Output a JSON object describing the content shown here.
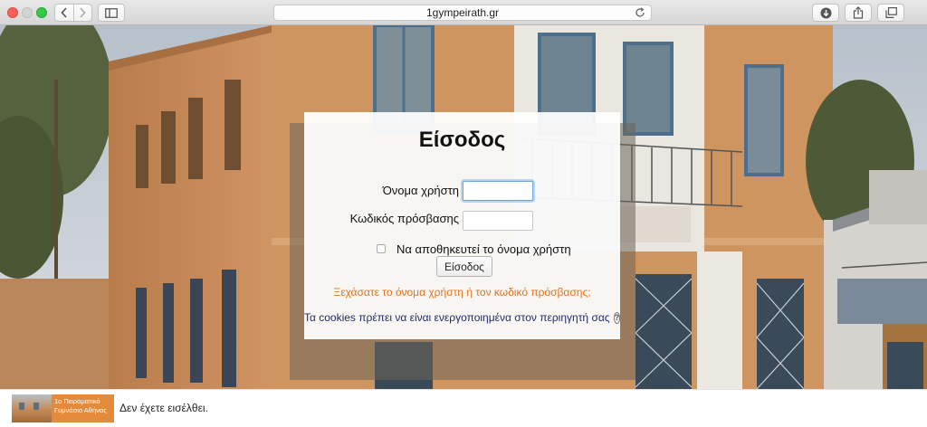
{
  "browser": {
    "address": "1gympeirath.gr",
    "icons": [
      "back-arrow-icon",
      "forward-arrow-icon",
      "sidebar-icon",
      "reload-icon",
      "download-icon",
      "share-icon",
      "tabs-icon"
    ]
  },
  "login": {
    "title": "Είσοδος",
    "username_label": "Όνομα χρήστη",
    "username_value": "",
    "password_label": "Κωδικός πρόσβασης",
    "password_value": "",
    "remember_label": "Να αποθηκευτεί το όνομα χρήστη",
    "remember_checked": false,
    "submit_label": "Είσοδος",
    "forgot_link": "Ξεχάσατε το όνομα χρήστη ή τον κωδικό πρόσβασης;",
    "cookies_notice": "Τα cookies πρέπει να είναι ενεργοποιημένα στον περιηγητή σας",
    "help_glyph": "?"
  },
  "footer": {
    "logo_lines": [
      "1ο Πειραματικό",
      "Γυμνάσιο Αθήνας"
    ],
    "login_status": "Δεν έχετε εισέλθει."
  },
  "colors": {
    "link": "#e2731f",
    "cookies_text": "#1f2a6b",
    "logo_bg": "#e38a3b"
  }
}
